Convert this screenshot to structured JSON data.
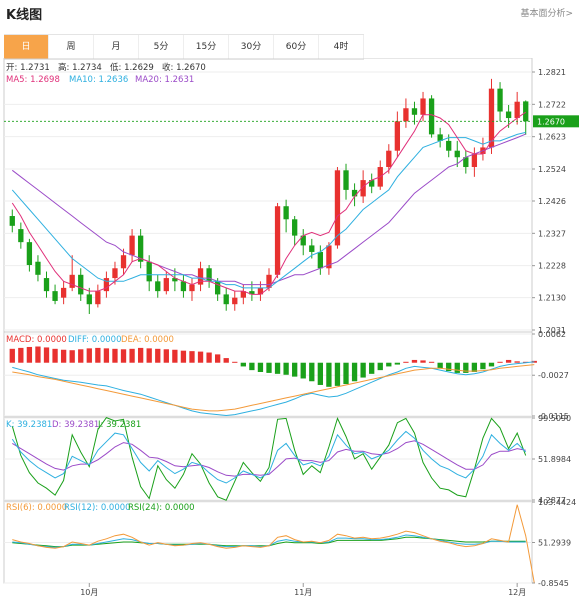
{
  "header": {
    "title": "K线图",
    "basic_analysis_link": "基本面分析>"
  },
  "tabs": [
    {
      "label": "日",
      "active": true
    },
    {
      "label": "周",
      "active": false
    },
    {
      "label": "月",
      "active": false
    },
    {
      "label": "5分",
      "active": false
    },
    {
      "label": "15分",
      "active": false
    },
    {
      "label": "30分",
      "active": false
    },
    {
      "label": "60分",
      "active": false
    },
    {
      "label": "4时",
      "active": false
    }
  ],
  "colors": {
    "up": "#e8312f",
    "down": "#1aa01a",
    "ma5": "#e0307a",
    "ma10": "#2fb0e0",
    "ma20": "#9b4bc8",
    "price_tag": "#1aa01a"
  },
  "ohlc_info": {
    "open": "开: 1.2731",
    "high": "高: 1.2734",
    "low": "低: 1.2629",
    "close": "收: 1.2670"
  },
  "ma_info": {
    "ma5": "MA5: 1.2698",
    "ma10": "MA10: 1.2636",
    "ma20": "MA20: 1.2631"
  },
  "macd_info": {
    "macd": "MACD: 0.0000",
    "diff": "DIFF: 0.0000",
    "dea": "DEA: 0.0000"
  },
  "kdj_info": {
    "k": "K: 39.2381",
    "d": "D: 39.2381",
    "j": "J: 39.2381"
  },
  "rsi_info": {
    "rsi6": "RSI(6): 0.0000",
    "rsi12": "RSI(12): 0.0000",
    "rsi24": "RSI(24): 0.0000"
  },
  "chart_data": {
    "type": "candlestick",
    "price_axis": {
      "ticks": [
        "1.2821",
        "1.2722",
        "1.2623",
        "1.2524",
        "1.2426",
        "1.2327",
        "1.2228",
        "1.2130",
        "1.2031"
      ],
      "min": 1.2031,
      "max": 1.2821
    },
    "current_price": "1.2670",
    "x_labels": [
      {
        "label": "10月",
        "index": 9
      },
      {
        "label": "11月",
        "index": 34
      },
      {
        "label": "12月",
        "index": 59
      }
    ],
    "candles": [
      [
        1.238,
        1.235,
        1.24,
        1.233
      ],
      [
        1.234,
        1.23,
        1.236,
        1.228
      ],
      [
        1.23,
        1.223,
        1.231,
        1.221
      ],
      [
        1.224,
        1.22,
        1.226,
        1.218
      ],
      [
        1.219,
        1.215,
        1.221,
        1.213
      ],
      [
        1.215,
        1.212,
        1.217,
        1.211
      ],
      [
        1.213,
        1.216,
        1.218,
        1.211
      ],
      [
        1.216,
        1.22,
        1.226,
        1.215
      ],
      [
        1.22,
        1.214,
        1.222,
        1.212
      ],
      [
        1.214,
        1.211,
        1.216,
        1.208
      ],
      [
        1.211,
        1.215,
        1.217,
        1.21
      ],
      [
        1.215,
        1.219,
        1.221,
        1.213
      ],
      [
        1.219,
        1.222,
        1.224,
        1.217
      ],
      [
        1.222,
        1.226,
        1.228,
        1.22
      ],
      [
        1.226,
        1.232,
        1.234,
        1.224
      ],
      [
        1.232,
        1.224,
        1.234,
        1.222
      ],
      [
        1.224,
        1.218,
        1.226,
        1.215
      ],
      [
        1.218,
        1.215,
        1.22,
        1.213
      ],
      [
        1.215,
        1.219,
        1.221,
        1.214
      ],
      [
        1.219,
        1.218,
        1.222,
        1.215
      ],
      [
        1.218,
        1.215,
        1.22,
        1.213
      ],
      [
        1.215,
        1.217,
        1.219,
        1.212
      ],
      [
        1.217,
        1.222,
        1.224,
        1.215
      ],
      [
        1.222,
        1.218,
        1.223,
        1.216
      ],
      [
        1.218,
        1.214,
        1.219,
        1.212
      ],
      [
        1.214,
        1.211,
        1.216,
        1.209
      ],
      [
        1.211,
        1.213,
        1.215,
        1.209
      ],
      [
        1.213,
        1.215,
        1.217,
        1.211
      ],
      [
        1.215,
        1.214,
        1.218,
        1.212
      ],
      [
        1.214,
        1.216,
        1.218,
        1.212
      ],
      [
        1.216,
        1.22,
        1.222,
        1.215
      ],
      [
        1.22,
        1.241,
        1.242,
        1.219
      ],
      [
        1.241,
        1.237,
        1.243,
        1.233
      ],
      [
        1.237,
        1.232,
        1.238,
        1.229
      ],
      [
        1.232,
        1.229,
        1.234,
        1.226
      ],
      [
        1.229,
        1.227,
        1.231,
        1.225
      ],
      [
        1.227,
        1.222,
        1.229,
        1.22
      ],
      [
        1.222,
        1.229,
        1.23,
        1.22
      ],
      [
        1.229,
        1.252,
        1.253,
        1.228
      ],
      [
        1.252,
        1.246,
        1.254,
        1.243
      ],
      [
        1.246,
        1.244,
        1.248,
        1.241
      ],
      [
        1.244,
        1.249,
        1.252,
        1.242
      ],
      [
        1.249,
        1.247,
        1.251,
        1.245
      ],
      [
        1.247,
        1.253,
        1.255,
        1.246
      ],
      [
        1.253,
        1.258,
        1.26,
        1.251
      ],
      [
        1.258,
        1.267,
        1.27,
        1.256
      ],
      [
        1.267,
        1.271,
        1.274,
        1.265
      ],
      [
        1.271,
        1.269,
        1.273,
        1.266
      ],
      [
        1.269,
        1.274,
        1.276,
        1.267
      ],
      [
        1.274,
        1.263,
        1.275,
        1.262
      ],
      [
        1.263,
        1.261,
        1.265,
        1.259
      ],
      [
        1.261,
        1.258,
        1.263,
        1.256
      ],
      [
        1.258,
        1.256,
        1.261,
        1.253
      ],
      [
        1.256,
        1.253,
        1.258,
        1.251
      ],
      [
        1.253,
        1.257,
        1.259,
        1.25
      ],
      [
        1.257,
        1.259,
        1.262,
        1.255
      ],
      [
        1.259,
        1.277,
        1.28,
        1.257
      ],
      [
        1.277,
        1.27,
        1.279,
        1.267
      ],
      [
        1.27,
        1.268,
        1.272,
        1.265
      ],
      [
        1.268,
        1.273,
        1.276,
        1.266
      ],
      [
        1.2731,
        1.267,
        1.2734,
        1.2629
      ]
    ],
    "ma5": [
      1.242,
      1.238,
      1.233,
      1.229,
      1.225,
      1.221,
      1.218,
      1.217,
      1.216,
      1.215,
      1.215,
      1.216,
      1.218,
      1.22,
      1.224,
      1.225,
      1.224,
      1.223,
      1.221,
      1.219,
      1.218,
      1.217,
      1.218,
      1.218,
      1.217,
      1.216,
      1.215,
      1.215,
      1.214,
      1.214,
      1.216,
      1.22,
      1.225,
      1.229,
      1.232,
      1.233,
      1.232,
      1.233,
      1.238,
      1.24,
      1.244,
      1.247,
      1.249,
      1.25,
      1.252,
      1.256,
      1.26,
      1.264,
      1.269,
      1.269,
      1.268,
      1.266,
      1.262,
      1.258,
      1.257,
      1.257,
      1.261,
      1.264,
      1.266,
      1.268,
      1.2698
    ],
    "ma10": [
      1.246,
      1.243,
      1.24,
      1.237,
      1.234,
      1.231,
      1.228,
      1.225,
      1.223,
      1.221,
      1.219,
      1.218,
      1.218,
      1.218,
      1.219,
      1.22,
      1.22,
      1.22,
      1.22,
      1.22,
      1.22,
      1.219,
      1.219,
      1.218,
      1.218,
      1.217,
      1.217,
      1.216,
      1.216,
      1.216,
      1.216,
      1.218,
      1.22,
      1.222,
      1.224,
      1.226,
      1.227,
      1.229,
      1.232,
      1.234,
      1.237,
      1.24,
      1.242,
      1.244,
      1.246,
      1.25,
      1.253,
      1.256,
      1.259,
      1.26,
      1.261,
      1.262,
      1.262,
      1.262,
      1.261,
      1.26,
      1.261,
      1.261,
      1.262,
      1.263,
      1.2636
    ],
    "ma20": [
      1.252,
      1.25,
      1.248,
      1.246,
      1.244,
      1.242,
      1.24,
      1.238,
      1.236,
      1.234,
      1.232,
      1.23,
      1.229,
      1.227,
      1.226,
      1.225,
      1.224,
      1.223,
      1.222,
      1.221,
      1.22,
      1.22,
      1.219,
      1.219,
      1.218,
      1.218,
      1.218,
      1.217,
      1.217,
      1.217,
      1.217,
      1.218,
      1.219,
      1.22,
      1.22,
      1.221,
      1.222,
      1.223,
      1.224,
      1.226,
      1.228,
      1.23,
      1.232,
      1.234,
      1.236,
      1.239,
      1.242,
      1.245,
      1.247,
      1.249,
      1.251,
      1.253,
      1.254,
      1.256,
      1.257,
      1.258,
      1.259,
      1.26,
      1.261,
      1.262,
      1.2631
    ],
    "macd_axis": {
      "ticks": [
        "0.0062",
        "-0.0027",
        "-0.0115"
      ],
      "min": -0.0115,
      "max": 0.0062
    },
    "macd_hist": [
      0.003,
      0.0032,
      0.0034,
      0.0035,
      0.0033,
      0.003,
      0.0028,
      0.0027,
      0.0029,
      0.0031,
      0.0032,
      0.0031,
      0.003,
      0.0029,
      0.003,
      0.0032,
      0.0031,
      0.003,
      0.0029,
      0.0028,
      0.0026,
      0.0025,
      0.0024,
      0.0022,
      0.0018,
      0.001,
      0.0002,
      -0.0008,
      -0.0016,
      -0.002,
      -0.0022,
      -0.0024,
      -0.0026,
      -0.003,
      -0.0034,
      -0.004,
      -0.0048,
      -0.0052,
      -0.005,
      -0.0046,
      -0.004,
      -0.0032,
      -0.0024,
      -0.0016,
      -0.0008,
      -0.0004,
      0.0002,
      0.0006,
      0.0005,
      0.0002,
      -0.0012,
      -0.0018,
      -0.0022,
      -0.0022,
      -0.002,
      -0.0014,
      -0.0008,
      0.0002,
      0.0006,
      0.0003,
      0.0002,
      0.0004
    ],
    "macd_diff": [
      -0.001,
      -0.0015,
      -0.002,
      -0.0026,
      -0.003,
      -0.0034,
      -0.0038,
      -0.004,
      -0.0042,
      -0.0045,
      -0.0048,
      -0.005,
      -0.0055,
      -0.006,
      -0.0064,
      -0.0068,
      -0.0074,
      -0.008,
      -0.0086,
      -0.0092,
      -0.0098,
      -0.0104,
      -0.0108,
      -0.011,
      -0.0112,
      -0.0114,
      -0.0112,
      -0.0108,
      -0.0104,
      -0.01,
      -0.0095,
      -0.009,
      -0.0085,
      -0.0078,
      -0.007,
      -0.0066,
      -0.007,
      -0.0074,
      -0.0072,
      -0.0066,
      -0.0058,
      -0.005,
      -0.0042,
      -0.0034,
      -0.0026,
      -0.002,
      -0.0012,
      -0.0008,
      -0.001,
      -0.0012,
      -0.0016,
      -0.002,
      -0.0024,
      -0.0026,
      -0.0024,
      -0.002,
      -0.0014,
      -0.0008,
      -0.0004,
      -0.0002,
      0.0,
      0.0002
    ],
    "macd_dea": [
      -0.002,
      -0.0023,
      -0.0026,
      -0.003,
      -0.0033,
      -0.0036,
      -0.004,
      -0.0044,
      -0.0048,
      -0.0052,
      -0.0056,
      -0.006,
      -0.0064,
      -0.0068,
      -0.0072,
      -0.0076,
      -0.008,
      -0.0084,
      -0.0088,
      -0.0092,
      -0.0096,
      -0.01,
      -0.0102,
      -0.0104,
      -0.0104,
      -0.0102,
      -0.01,
      -0.0096,
      -0.0092,
      -0.0088,
      -0.0084,
      -0.008,
      -0.0076,
      -0.0072,
      -0.0068,
      -0.0064,
      -0.006,
      -0.0056,
      -0.0052,
      -0.0048,
      -0.0044,
      -0.004,
      -0.0036,
      -0.0032,
      -0.0028,
      -0.0024,
      -0.002,
      -0.0016,
      -0.0014,
      -0.0012,
      -0.0012,
      -0.0014,
      -0.0016,
      -0.0018,
      -0.0018,
      -0.0017,
      -0.0015,
      -0.0012,
      -0.001,
      -0.0008,
      -0.0006,
      -0.0004
    ],
    "kdj_axis": {
      "ticks": [
        "99.5090",
        "51.8984",
        "4.2877"
      ],
      "min": 4.2877,
      "max": 99.509
    },
    "kdj_k": [
      75,
      60,
      50,
      42,
      36,
      30,
      35,
      55,
      50,
      45,
      62,
      72,
      82,
      80,
      64,
      48,
      38,
      50,
      42,
      35,
      40,
      48,
      45,
      36,
      28,
      24,
      30,
      38,
      34,
      30,
      36,
      62,
      70,
      56,
      45,
      48,
      44,
      55,
      80,
      68,
      58,
      60,
      52,
      56,
      62,
      74,
      84,
      76,
      62,
      52,
      44,
      40,
      34,
      30,
      40,
      55,
      80,
      70,
      62,
      70,
      60
    ],
    "kdj_d": [
      70,
      64,
      58,
      52,
      46,
      41,
      39,
      44,
      46,
      46,
      51,
      58,
      66,
      71,
      69,
      62,
      54,
      53,
      49,
      44,
      43,
      44,
      45,
      42,
      37,
      33,
      32,
      34,
      34,
      33,
      34,
      43,
      52,
      53,
      50,
      50,
      48,
      50,
      60,
      63,
      61,
      61,
      58,
      57,
      59,
      64,
      71,
      73,
      69,
      63,
      57,
      51,
      45,
      40,
      40,
      45,
      57,
      61,
      61,
      64,
      62
    ],
    "kdj_j": [
      90,
      56,
      36,
      24,
      18,
      10,
      27,
      80,
      60,
      43,
      86,
      100,
      96,
      98,
      54,
      20,
      6,
      44,
      28,
      18,
      34,
      58,
      46,
      24,
      8,
      4,
      26,
      48,
      36,
      26,
      42,
      98,
      99,
      62,
      34,
      44,
      36,
      66,
      99,
      78,
      52,
      58,
      40,
      54,
      68,
      94,
      99,
      82,
      48,
      30,
      18,
      16,
      10,
      8,
      40,
      76,
      99,
      88,
      64,
      82,
      56
    ],
    "rsi_axis": {
      "ticks": [
        "103.4424",
        "51.2939",
        "-0.8545"
      ],
      "min": -0.8545,
      "max": 103.4424
    },
    "rsi6": [
      55,
      52,
      50,
      47,
      45,
      44,
      46,
      52,
      50,
      48,
      53,
      56,
      60,
      62,
      58,
      52,
      48,
      51,
      49,
      47,
      48,
      50,
      51,
      49,
      46,
      44,
      45,
      47,
      46,
      45,
      47,
      58,
      60,
      55,
      52,
      53,
      51,
      54,
      62,
      60,
      57,
      58,
      56,
      57,
      59,
      62,
      66,
      64,
      60,
      56,
      53,
      51,
      48,
      46,
      47,
      50,
      56,
      54,
      52,
      100,
      60,
      -0.8
    ],
    "rsi12": [
      52,
      51,
      49,
      47,
      46,
      45,
      46,
      49,
      49,
      48,
      50,
      52,
      54,
      56,
      55,
      52,
      50,
      50,
      49,
      48,
      48,
      49,
      50,
      49,
      47,
      46,
      46,
      47,
      47,
      46,
      47,
      53,
      55,
      53,
      52,
      52,
      51,
      52,
      57,
      57,
      56,
      56,
      55,
      55,
      56,
      58,
      61,
      60,
      58,
      56,
      54,
      52,
      50,
      49,
      49,
      50,
      53,
      53,
      52,
      52,
      52
    ],
    "rsi24": [
      51,
      50,
      49,
      48,
      47,
      46,
      46,
      48,
      48,
      48,
      49,
      50,
      51,
      52,
      52,
      51,
      50,
      50,
      49,
      49,
      49,
      49,
      49,
      49,
      48,
      47,
      47,
      47,
      47,
      47,
      47,
      50,
      52,
      51,
      51,
      51,
      50,
      51,
      54,
      54,
      54,
      54,
      54,
      54,
      55,
      56,
      58,
      58,
      57,
      56,
      55,
      54,
      53,
      52,
      52,
      52,
      53,
      53,
      53,
      53,
      53
    ]
  }
}
